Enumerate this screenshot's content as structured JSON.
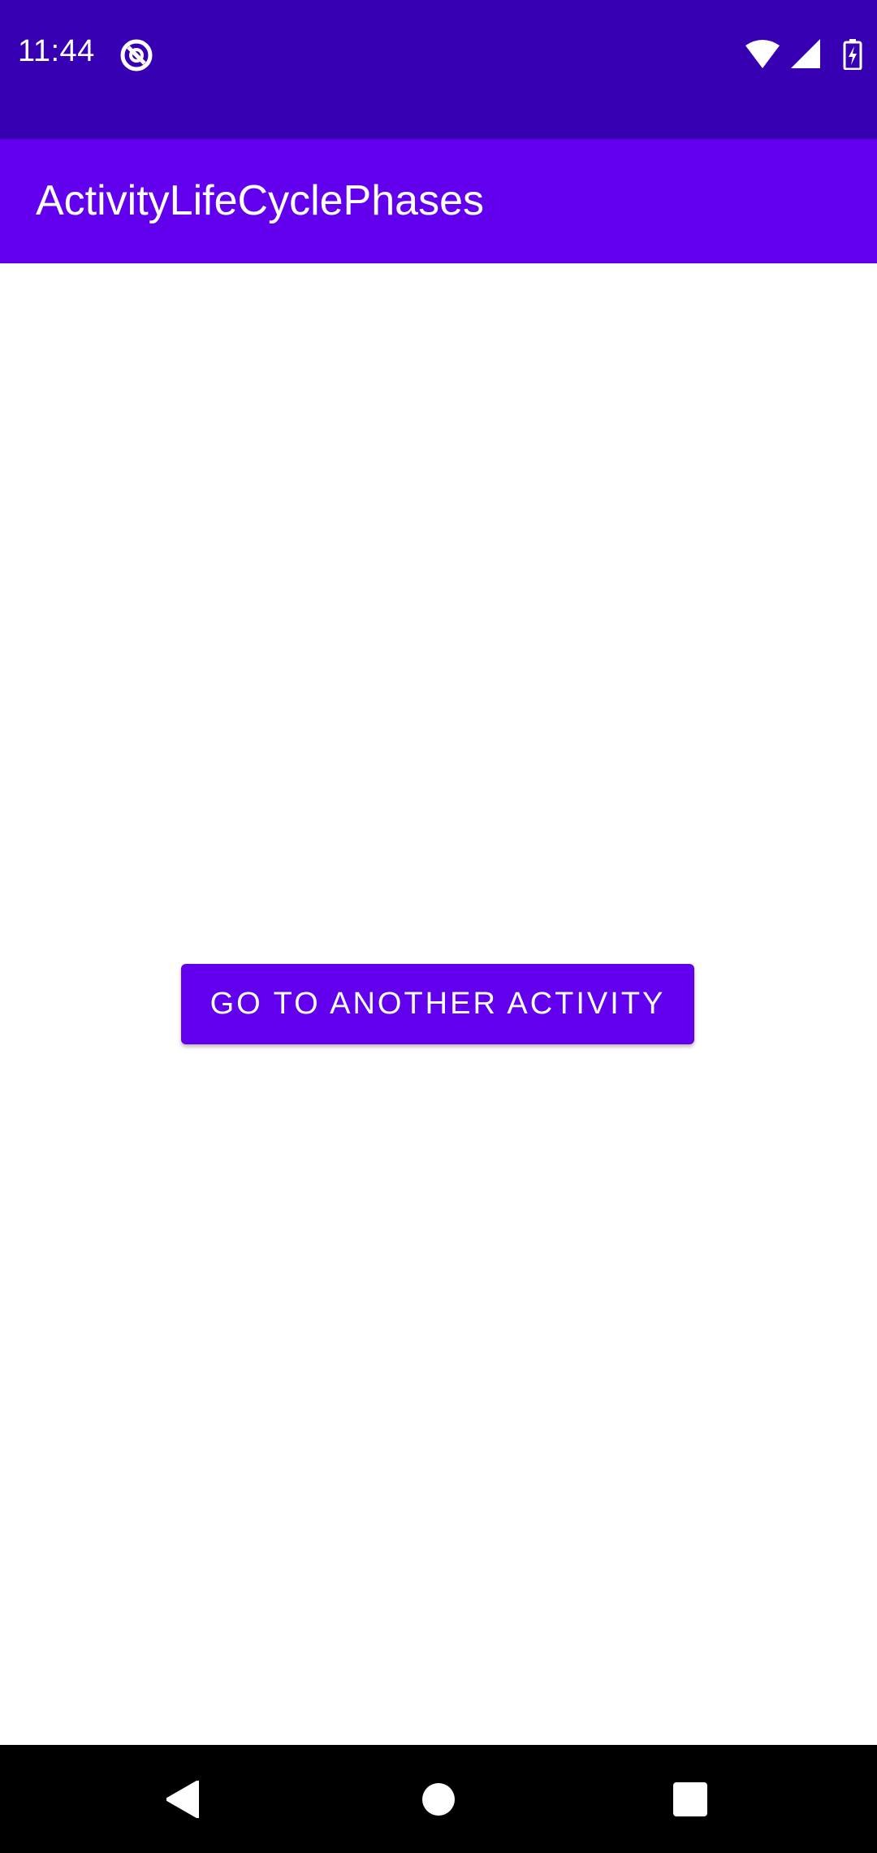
{
  "status_bar": {
    "time": "11:44",
    "icons": [
      "app-notification-icon",
      "wifi-icon",
      "cellular-signal-icon",
      "battery-charging-icon"
    ],
    "background": "#3700b3"
  },
  "app_bar": {
    "title": "ActivityLifeCyclePhases",
    "background": "#6200ee"
  },
  "main": {
    "button_label": "Go to another activity",
    "button_color": "#6200ee"
  },
  "nav_bar": {
    "icons": [
      "back-icon",
      "home-icon",
      "recents-icon"
    ],
    "background": "#000000"
  }
}
